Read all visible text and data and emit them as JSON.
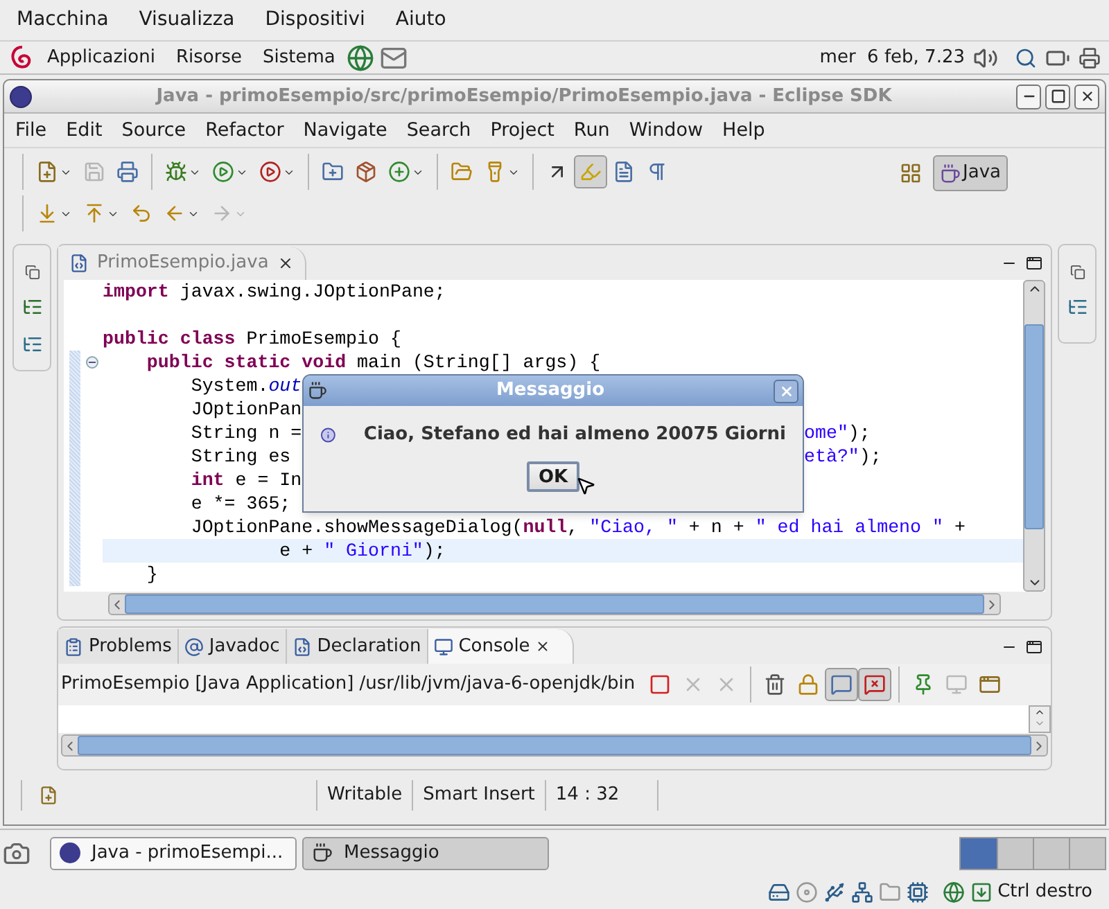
{
  "vm_menu": [
    "Macchina",
    "Visualizza",
    "Dispositivi",
    "Aiuto"
  ],
  "gnome_panel": {
    "menus": [
      "Applicazioni",
      "Risorse",
      "Sistema"
    ],
    "clock": "mer  6 feb, 7.23"
  },
  "window": {
    "title": "Java - primoEsempio/src/primoEsempio/PrimoEsempio.java - Eclipse SDK"
  },
  "menu_bar": [
    "File",
    "Edit",
    "Source",
    "Refactor",
    "Navigate",
    "Search",
    "Project",
    "Run",
    "Window",
    "Help"
  ],
  "toolbar_rows": [
    [
      {
        "kind": "new",
        "dropdown": true,
        "disabled": false,
        "pressed": false
      },
      {
        "kind": "save",
        "dropdown": false,
        "disabled": true,
        "pressed": false
      },
      {
        "kind": "print",
        "dropdown": false,
        "disabled": false,
        "pressed": false
      },
      {
        "kind": "sep"
      },
      {
        "kind": "debug",
        "dropdown": true,
        "disabled": false,
        "pressed": false
      },
      {
        "kind": "run",
        "dropdown": true,
        "disabled": false,
        "pressed": false
      },
      {
        "kind": "external",
        "dropdown": true,
        "disabled": false,
        "pressed": false
      },
      {
        "kind": "sep"
      },
      {
        "kind": "new_project",
        "dropdown": false,
        "disabled": false,
        "pressed": false
      },
      {
        "kind": "new_package",
        "dropdown": false,
        "disabled": false,
        "pressed": false
      },
      {
        "kind": "new_class",
        "dropdown": true,
        "disabled": false,
        "pressed": false
      },
      {
        "kind": "sep"
      },
      {
        "kind": "open_type",
        "dropdown": false,
        "disabled": false,
        "pressed": false
      },
      {
        "kind": "search",
        "dropdown": true,
        "disabled": false,
        "pressed": false
      },
      {
        "kind": "sep"
      },
      {
        "kind": "breadcrumb",
        "dropdown": false,
        "disabled": false,
        "pressed": false
      },
      {
        "kind": "highlight",
        "dropdown": false,
        "disabled": false,
        "pressed": true
      },
      {
        "kind": "block",
        "dropdown": false,
        "disabled": false,
        "pressed": false
      },
      {
        "kind": "whitespace",
        "dropdown": false,
        "disabled": false,
        "pressed": false
      }
    ],
    [
      {
        "kind": "next_annotation",
        "dropdown": true,
        "disabled": false,
        "pressed": false
      },
      {
        "kind": "prev_annotation",
        "dropdown": true,
        "disabled": false,
        "pressed": false
      },
      {
        "kind": "last_edit",
        "dropdown": false,
        "disabled": false,
        "pressed": false
      },
      {
        "kind": "back",
        "dropdown": true,
        "disabled": false,
        "pressed": false
      },
      {
        "kind": "forward",
        "dropdown": true,
        "disabled": true,
        "pressed": false
      }
    ]
  ],
  "perspective": {
    "label": "Java",
    "selected": true
  },
  "editor": {
    "tab": "PrimoEsempio.java",
    "lines": [
      {
        "highlighted": false,
        "folding": false,
        "segments": [
          {
            "kind": "keyword",
            "text": "import"
          },
          {
            "kind": "plain",
            "text": " javax.swing.JOptionPane;"
          }
        ]
      },
      {
        "folding": false
      },
      {
        "highlighted": false,
        "folding": false,
        "segments": [
          {
            "kind": "keyword",
            "text": "public class"
          },
          {
            "kind": "plain",
            "text": " PrimoEsempio {"
          }
        ]
      },
      {
        "highlighted": false,
        "folding": true,
        "segments": [
          {
            "kind": "keyword",
            "text": "    public static void"
          },
          {
            "kind": "plain",
            "text": " main (String[] args) {"
          }
        ]
      },
      {
        "highlighted": false,
        "folding": false,
        "segments": [
          {
            "kind": "plain",
            "text": "        System."
          },
          {
            "kind": "field",
            "text": "out"
          }
        ]
      },
      {
        "highlighted": false,
        "folding": false,
        "segments": [
          {
            "kind": "plain",
            "text": "        JOptionPan"
          }
        ]
      },
      {
        "highlighted": false,
        "folding": false,
        "segments": [
          {
            "kind": "plain",
            "text": "        String n = "
          }
        ],
        "right_segments": [
          {
            "kind": "string",
            "text": "ome\""
          },
          {
            "kind": "plain",
            "text": ");"
          }
        ]
      },
      {
        "highlighted": false,
        "folding": false,
        "segments": [
          {
            "kind": "plain",
            "text": "        String es"
          }
        ],
        "right_segments": [
          {
            "kind": "string",
            "text": "età?\""
          },
          {
            "kind": "plain",
            "text": ");"
          }
        ]
      },
      {
        "highlighted": false,
        "folding": false,
        "segments": [
          {
            "kind": "keyword",
            "text": "        int"
          },
          {
            "kind": "plain",
            "text": " e = In"
          }
        ]
      },
      {
        "highlighted": false,
        "folding": false,
        "segments": [
          {
            "kind": "plain",
            "text": "        e *= 365;"
          }
        ]
      },
      {
        "highlighted": false,
        "folding": false,
        "segments": [
          {
            "kind": "plain",
            "text": "        JOptionPane.showMessageDialog("
          },
          {
            "kind": "keyword",
            "text": "null"
          },
          {
            "kind": "plain",
            "text": ", "
          },
          {
            "kind": "string",
            "text": "\"Ciao, \""
          },
          {
            "kind": "plain",
            "text": " + n + "
          },
          {
            "kind": "string",
            "text": "\" ed hai almeno \""
          },
          {
            "kind": "plain",
            "text": " +"
          }
        ]
      },
      {
        "highlighted": true,
        "folding": false,
        "segments": [
          {
            "kind": "plain",
            "text": "                e + "
          },
          {
            "kind": "string",
            "text": "\" Giorni\""
          },
          {
            "kind": "plain",
            "text": ");"
          }
        ]
      },
      {
        "highlighted": false,
        "folding": false,
        "segments": [
          {
            "kind": "plain",
            "text": "    }"
          }
        ]
      }
    ]
  },
  "dialog": {
    "title": "Messaggio",
    "message": "Ciao, Stefano ed hai almeno 20075 Giorni",
    "button": "OK"
  },
  "bottom_panel": {
    "tabs": [
      {
        "label": "Problems",
        "kind": "problems",
        "selected": false
      },
      {
        "label": "Javadoc",
        "kind": "javadoc",
        "selected": false
      },
      {
        "label": "Declaration",
        "kind": "declaration",
        "selected": false
      },
      {
        "label": "Console",
        "kind": "console",
        "selected": true
      }
    ],
    "console_title": "PrimoEsempio [Java Application] /usr/lib/jvm/java-6-openjdk/bin",
    "toolbar": [
      {
        "kind": "terminate",
        "disabled": false,
        "pressed": false
      },
      {
        "kind": "remove",
        "disabled": true,
        "pressed": false
      },
      {
        "kind": "remove_all",
        "disabled": true,
        "pressed": false
      },
      {
        "kind": "sep"
      },
      {
        "kind": "clear",
        "disabled": false,
        "pressed": false
      },
      {
        "kind": "scroll_lock",
        "disabled": false,
        "pressed": false
      },
      {
        "kind": "stdout",
        "disabled": false,
        "pressed": true
      },
      {
        "kind": "stderr",
        "disabled": false,
        "pressed": true
      },
      {
        "kind": "sep"
      },
      {
        "kind": "pin",
        "disabled": false,
        "pressed": false
      },
      {
        "kind": "display",
        "disabled": true,
        "pressed": false
      },
      {
        "kind": "open_console",
        "disabled": false,
        "pressed": false
      }
    ]
  },
  "status_bar": [
    "Writable",
    "Smart Insert",
    "14 : 32"
  ],
  "taskbar": [
    {
      "label": "Java - primoEsempi...",
      "kind": "eclipse",
      "selected": false
    },
    {
      "label": "Messaggio",
      "kind": "java",
      "selected": true
    }
  ],
  "vm_status": {
    "host_key": "Ctrl destro"
  }
}
